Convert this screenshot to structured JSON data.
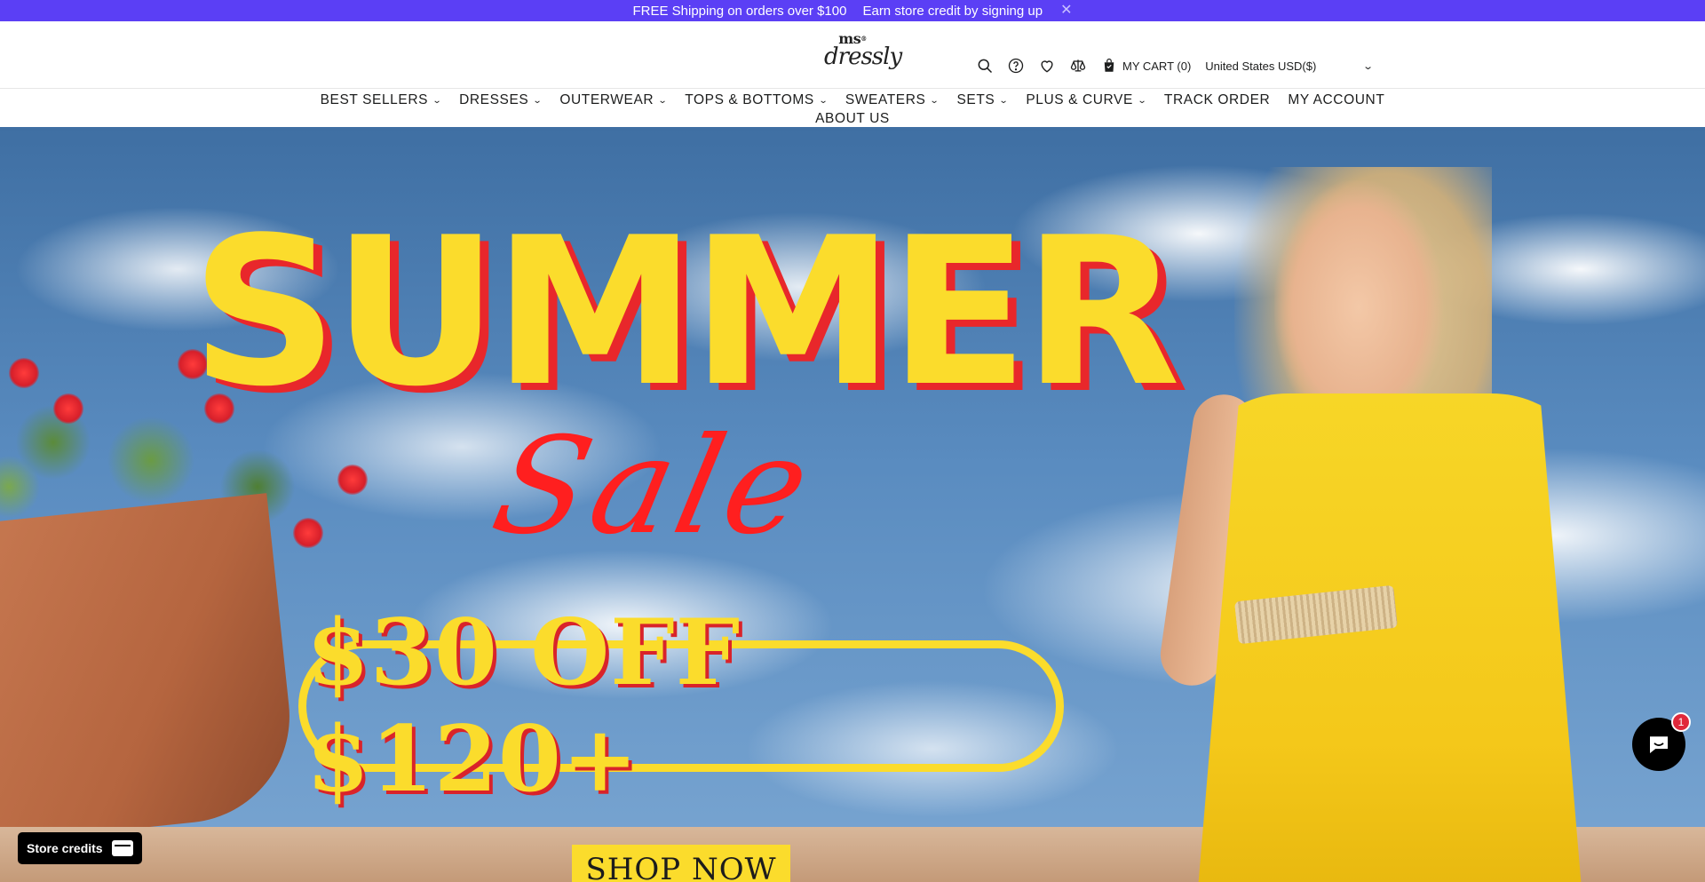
{
  "announcement": {
    "text1": "FREE Shipping on orders over $100",
    "text2": "Earn store credit by signing up",
    "close": "✕"
  },
  "header": {
    "logo_top": "ms",
    "logo_reg": "®",
    "logo_bottom": "dressly",
    "icons": [
      "search-icon",
      "help-icon",
      "heart-icon",
      "compare-icon",
      "cart-icon"
    ],
    "cart_label": "MY CART (0)",
    "currency": "United States USD($)",
    "currency_chevron": "⌄"
  },
  "nav": {
    "items": [
      {
        "label": "BEST SELLERS",
        "has_dropdown": true
      },
      {
        "label": "DRESSES",
        "has_dropdown": true
      },
      {
        "label": "OUTERWEAR",
        "has_dropdown": true
      },
      {
        "label": "TOPS & BOTTOMS",
        "has_dropdown": true
      },
      {
        "label": "SWEATERS",
        "has_dropdown": true
      },
      {
        "label": "SETS",
        "has_dropdown": true
      },
      {
        "label": "PLUS & CURVE",
        "has_dropdown": true
      },
      {
        "label": "TRACK ORDER",
        "has_dropdown": false
      },
      {
        "label": "MY ACCOUNT",
        "has_dropdown": false
      },
      {
        "label": "ABOUT US",
        "has_dropdown": false
      }
    ],
    "chevron": "⌄"
  },
  "hero": {
    "headline": "SUMMER",
    "script": "Sale",
    "offer": "$30 OFF $120+",
    "cta": "SHOP NOW",
    "colors": {
      "yellow": "#fbdc2c",
      "red": "#e8272b",
      "sky": "#5a8cc0"
    }
  },
  "widgets": {
    "store_credits": "Store credits",
    "chat_badge": "1"
  },
  "colors": {
    "announcement_bg": "#5b3ff5",
    "text": "#1c1d1d"
  }
}
